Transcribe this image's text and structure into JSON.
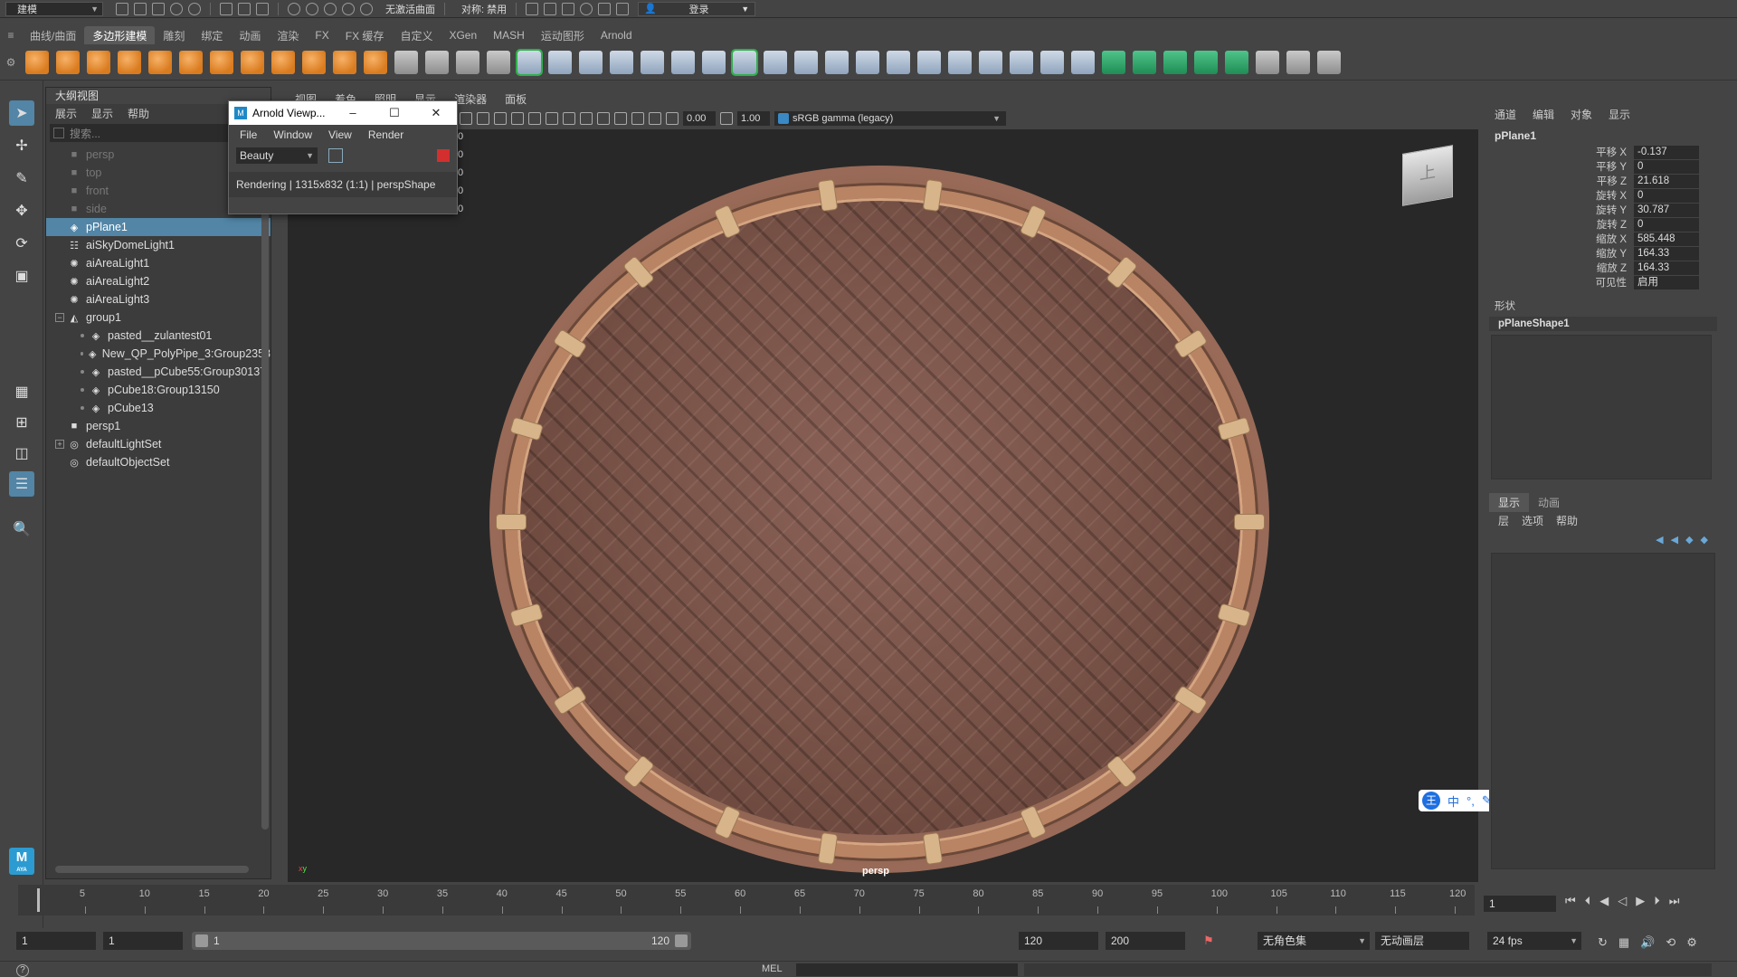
{
  "topbar": {
    "mode": "建模",
    "live_surface": "无激活曲面",
    "symmetry": "对称: 禁用",
    "login": "登录"
  },
  "shelf_tabs": [
    "曲线/曲面",
    "多边形建模",
    "雕刻",
    "绑定",
    "动画",
    "渲染",
    "FX",
    "FX 缓存",
    "自定义",
    "XGen",
    "MASH",
    "运动图形",
    "Arnold"
  ],
  "shelf_active": "多边形建模",
  "outliner": {
    "title": "大纲视图",
    "menu": [
      "展示",
      "显示",
      "帮助"
    ],
    "search_placeholder": "搜索...",
    "items": [
      {
        "label": "persp",
        "icon": "camera-icon",
        "dim": true
      },
      {
        "label": "top",
        "icon": "camera-icon",
        "dim": true
      },
      {
        "label": "front",
        "icon": "camera-icon",
        "dim": true
      },
      {
        "label": "side",
        "icon": "camera-icon",
        "dim": true
      },
      {
        "label": "pPlane1",
        "icon": "mesh-icon",
        "selected": true
      },
      {
        "label": "aiSkyDomeLight1",
        "icon": "skydome-icon"
      },
      {
        "label": "aiAreaLight1",
        "icon": "light-icon"
      },
      {
        "label": "aiAreaLight2",
        "icon": "light-icon"
      },
      {
        "label": "aiAreaLight3",
        "icon": "light-icon"
      },
      {
        "label": "group1",
        "icon": "group-icon",
        "expand": "−"
      },
      {
        "label": "pasted__zulantest01",
        "icon": "mesh-icon",
        "indent": true
      },
      {
        "label": "New_QP_PolyPipe_3:Group2358",
        "icon": "mesh-icon",
        "indent": true
      },
      {
        "label": "pasted__pCube55:Group30137",
        "icon": "mesh-icon",
        "indent": true
      },
      {
        "label": "pCube18:Group13150",
        "icon": "mesh-icon",
        "indent": true
      },
      {
        "label": "pCube13",
        "icon": "mesh-icon",
        "indent": true
      },
      {
        "label": "persp1",
        "icon": "camera-icon"
      },
      {
        "label": "defaultLightSet",
        "icon": "set-icon",
        "expand": "+"
      },
      {
        "label": "defaultObjectSet",
        "icon": "set-icon"
      }
    ]
  },
  "viewport": {
    "menu": [
      "视图",
      "着色",
      "照明",
      "显示",
      "渲染器",
      "面板"
    ],
    "exposure": "0.00",
    "gamma": "1.00",
    "color_space": "sRGB gamma (legacy)",
    "camera_label": "persp",
    "hud_values": [
      "0",
      "0",
      "0",
      "0",
      "0"
    ]
  },
  "arnold_window": {
    "title": "Arnold Viewp...",
    "menu": [
      "File",
      "Window",
      "View",
      "Render"
    ],
    "aov": "Beauty",
    "status": "Rendering | 1315x832 (1:1) | perspShape"
  },
  "channel_box": {
    "menu": [
      "通道",
      "编辑",
      "对象",
      "显示"
    ],
    "object": "pPlane1",
    "attrs": [
      {
        "label": "平移 X",
        "value": "-0.137"
      },
      {
        "label": "平移 Y",
        "value": "0"
      },
      {
        "label": "平移 Z",
        "value": "21.618"
      },
      {
        "label": "旋转 X",
        "value": "0"
      },
      {
        "label": "旋转 Y",
        "value": "30.787"
      },
      {
        "label": "旋转 Z",
        "value": "0"
      },
      {
        "label": "缩放 X",
        "value": "585.448"
      },
      {
        "label": "缩放 Y",
        "value": "164.33"
      },
      {
        "label": "缩放 Z",
        "value": "164.33"
      },
      {
        "label": "可见性",
        "value": "启用"
      }
    ],
    "shapes_label": "形状",
    "shape": "pPlaneShape1"
  },
  "layer_editor": {
    "tabs": [
      "显示",
      "动画"
    ],
    "menu": [
      "层",
      "选项",
      "帮助"
    ]
  },
  "timeline": {
    "ticks": [
      "5",
      "10",
      "15",
      "20",
      "25",
      "30",
      "35",
      "40",
      "45",
      "50",
      "55",
      "60",
      "65",
      "70",
      "75",
      "80",
      "85",
      "90",
      "95",
      "100",
      "105",
      "110",
      "115",
      "120"
    ],
    "current_frame": "1"
  },
  "range": {
    "start": "1",
    "playback_start": "1",
    "slider_start": "1",
    "slider_end": "120",
    "playback_end": "120",
    "end": "200",
    "character_set": "无角色集",
    "anim_layer": "无动画层",
    "fps": "24 fps"
  },
  "cmdline": {
    "label": "MEL",
    "help": "?"
  },
  "ime": {
    "logo": "王",
    "items": [
      "中",
      "°,",
      "✎",
      "✂",
      "⌨",
      "👕",
      "⚙"
    ]
  }
}
